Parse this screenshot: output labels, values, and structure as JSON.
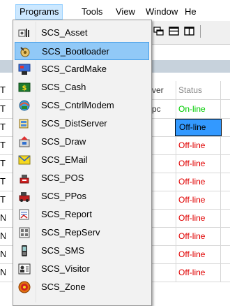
{
  "menubar": {
    "items": [
      {
        "label": "Programs"
      },
      {
        "label": "Tools"
      },
      {
        "label": "View"
      },
      {
        "label": "Window"
      },
      {
        "label": "He"
      }
    ]
  },
  "grid": {
    "column_headers": [
      "ver",
      "Status"
    ],
    "rows": [
      {
        "c1": "T",
        "c3": "",
        "status": "",
        "status_kind": "none"
      },
      {
        "c1": "T",
        "c3": "pc",
        "status": "On-line",
        "status_kind": "on"
      },
      {
        "c1": "T",
        "c3": "",
        "status": "Off-line",
        "status_kind": "off"
      },
      {
        "c1": "T",
        "c3": "",
        "status": "Off-line",
        "status_kind": "off"
      },
      {
        "c1": "T",
        "c3": "",
        "status": "Off-line",
        "status_kind": "off"
      },
      {
        "c1": "T",
        "c3": "",
        "status": "Off-line",
        "status_kind": "off"
      },
      {
        "c1": "T",
        "c3": "",
        "status": "Off-line",
        "status_kind": "off"
      },
      {
        "c1": "N",
        "c3": "",
        "status": "Off-line",
        "status_kind": "off"
      },
      {
        "c1": "N",
        "c3": "",
        "status": "Off-line",
        "status_kind": "off"
      },
      {
        "c1": "N",
        "c3": "",
        "status": "Off-line",
        "status_kind": "off"
      },
      {
        "c1": "N",
        "c3": "",
        "status": "Off-line",
        "status_kind": "off"
      }
    ],
    "highlighted_row": 2
  },
  "programs_menu": {
    "items": [
      {
        "label": "SCS_Asset",
        "icon": "asset-icon"
      },
      {
        "label": "SCS_Bootloader",
        "icon": "bootloader-icon"
      },
      {
        "label": "SCS_CardMake",
        "icon": "cardmake-icon"
      },
      {
        "label": "SCS_Cash",
        "icon": "cash-icon"
      },
      {
        "label": "SCS_CntrlModem",
        "icon": "modem-icon"
      },
      {
        "label": "SCS_DistServer",
        "icon": "distserver-icon"
      },
      {
        "label": "SCS_Draw",
        "icon": "draw-icon"
      },
      {
        "label": "SCS_EMail",
        "icon": "email-icon"
      },
      {
        "label": "SCS_POS",
        "icon": "pos-icon"
      },
      {
        "label": "SCS_PPos",
        "icon": "ppos-icon"
      },
      {
        "label": "SCS_Report",
        "icon": "report-icon"
      },
      {
        "label": "SCS_RepServ",
        "icon": "repserv-icon"
      },
      {
        "label": "SCS_SMS",
        "icon": "sms-icon"
      },
      {
        "label": "SCS_Visitor",
        "icon": "visitor-icon"
      },
      {
        "label": "SCS_Zone",
        "icon": "zone-icon"
      }
    ],
    "selected_index": 1
  },
  "colors": {
    "online": "#00cc00",
    "offline": "#e00000",
    "selection": "#3399ff",
    "menu_hover": "#91c9f7"
  }
}
